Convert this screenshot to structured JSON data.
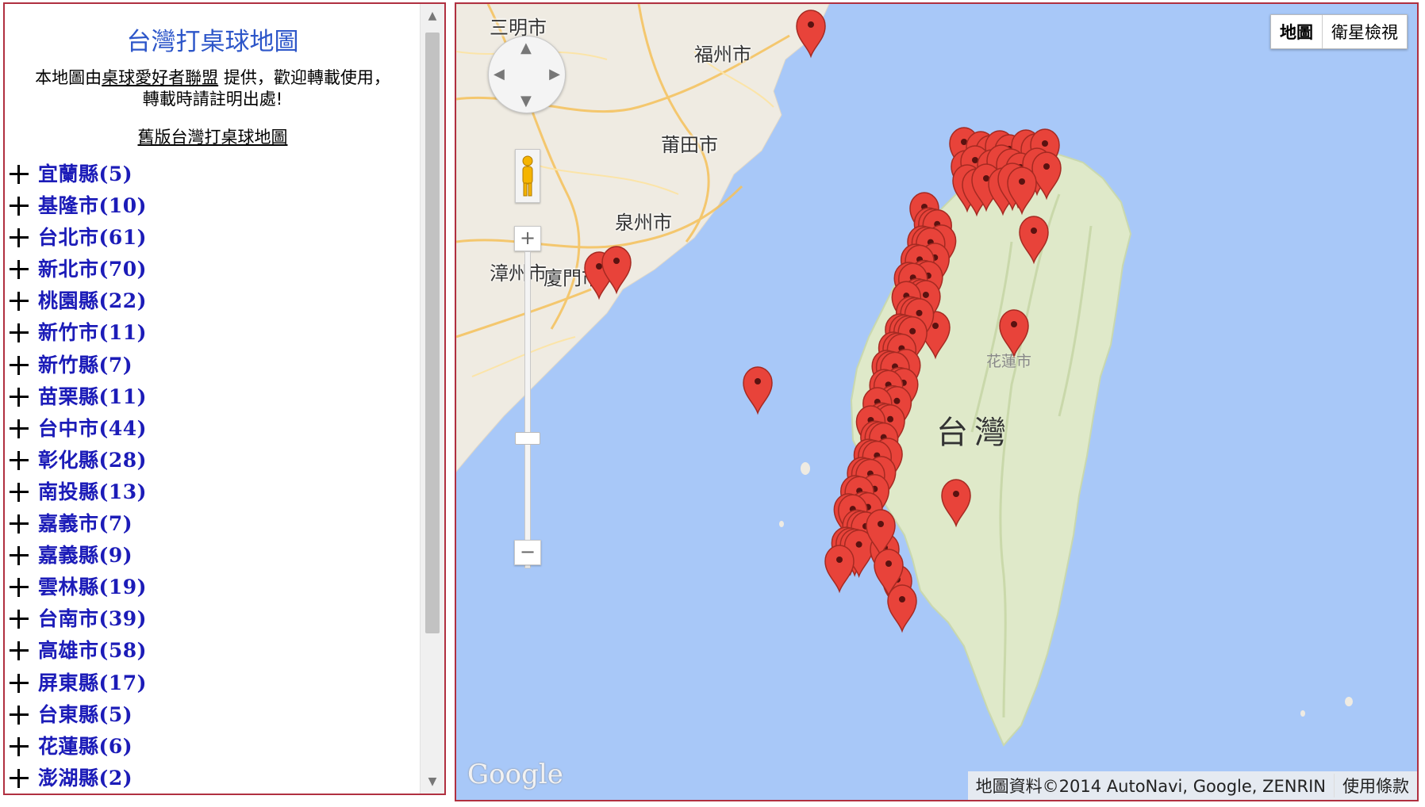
{
  "sidebar": {
    "title": "台灣打桌球地圖",
    "intro_prefix": "本地圖由",
    "intro_link": "桌球愛好者聯盟",
    "intro_suffix": " 提供，歡迎轉載使用，",
    "intro_line2": "轉載時請註明出處!",
    "old_version_link": "舊版台灣打桌球地圖",
    "counties": [
      "宜蘭縣(5)",
      "基隆市(10)",
      "台北市(61)",
      "新北市(70)",
      "桃園縣(22)",
      "新竹市(11)",
      "新竹縣(7)",
      "苗栗縣(11)",
      "台中市(44)",
      "彰化縣(28)",
      "南投縣(13)",
      "嘉義市(7)",
      "嘉義縣(9)",
      "雲林縣(19)",
      "台南市(39)",
      "高雄市(58)",
      "屏東縣(17)",
      "台東縣(5)",
      "花蓮縣(6)",
      "澎湖縣(2)"
    ]
  },
  "map": {
    "type_buttons": [
      "地圖",
      "衛星檢視"
    ],
    "active_type": "地圖",
    "labels": {
      "sanming": "三明市",
      "fuzhou": "福州市",
      "putian": "莆田市",
      "quanzhou": "泉州市",
      "zhangzhou": "漳州市",
      "xiamen": "廈門市",
      "hualien": "花蓮市",
      "taiwan": "台灣"
    },
    "logo": "Google",
    "attribution": "地圖資料©2014 AutoNavi, Google, ZENRIN",
    "terms": "使用條款",
    "colors": {
      "water": "#a8c8f8",
      "land": "#efebe2",
      "taiwan_land": "#dfe9c9",
      "marker": "#e8433a"
    }
  }
}
